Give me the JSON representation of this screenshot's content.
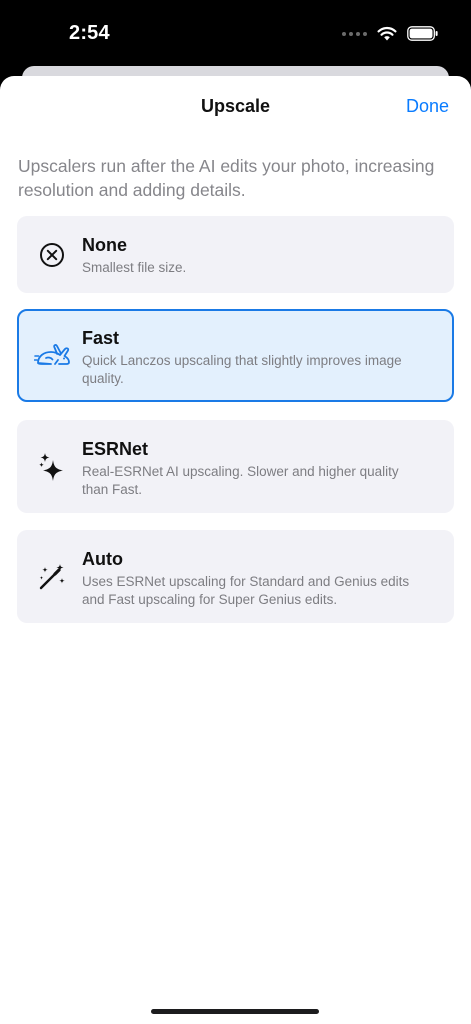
{
  "status_bar": {
    "time": "2:54"
  },
  "sheet": {
    "title": "Upscale",
    "done_label": "Done",
    "description": "Upscalers run after the AI edits your photo, increasing resolution and adding details."
  },
  "options": [
    {
      "icon": "x-circle-icon",
      "title": "None",
      "description": "Smallest file size.",
      "selected": false
    },
    {
      "icon": "rabbit-icon",
      "title": "Fast",
      "description": "Quick Lanczos upscaling that slightly improves image quality.",
      "selected": true
    },
    {
      "icon": "sparkles-icon",
      "title": "ESRNet",
      "description": "Real-ESRNet AI upscaling. Slower and higher quality than Fast.",
      "selected": false
    },
    {
      "icon": "magic-wand-icon",
      "title": "Auto",
      "description": "Uses ESRNet upscaling for Standard and Genius edits and Fast upscaling for Super Genius edits.",
      "selected": false
    }
  ],
  "colors": {
    "accent": "#0a7cff",
    "selected_border": "#1a7ae6",
    "selected_bg": "#e3f0fd",
    "card_bg": "#f2f2f7"
  }
}
